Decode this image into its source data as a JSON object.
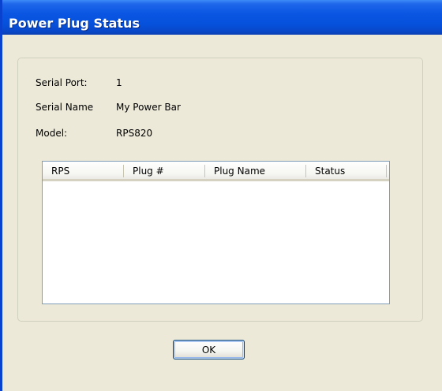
{
  "window": {
    "title": "Power Plug Status"
  },
  "info": {
    "serial_port_label": "Serial Port:",
    "serial_port_value": "1",
    "serial_name_label": "Serial Name",
    "serial_name_value": "My Power Bar",
    "model_label": "Model:",
    "model_value": "RPS820"
  },
  "table": {
    "columns": [
      "RPS",
      "Plug #",
      "Plug Name",
      "Status"
    ],
    "rows": []
  },
  "buttons": {
    "ok_label": "OK"
  }
}
